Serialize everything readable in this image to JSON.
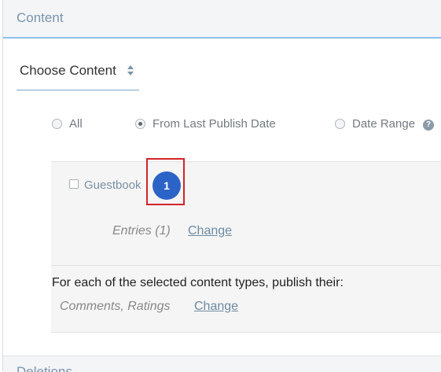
{
  "section": {
    "title": "Content"
  },
  "chooser": {
    "label": "Choose Content"
  },
  "radios": [
    {
      "label": "All",
      "checked": false
    },
    {
      "label": "From Last Publish Date",
      "checked": true
    },
    {
      "label": "Date Range",
      "checked": false
    }
  ],
  "help": {
    "glyph": "?"
  },
  "content_types": [
    {
      "label": "Guestbook",
      "checked": false,
      "badge": "1"
    }
  ],
  "entries": {
    "text": "Entries (1)",
    "change_label": "Change"
  },
  "publish": {
    "prompt": "For each of the selected content types, publish their:",
    "items_text": "Comments, Ratings",
    "change_label": "Change"
  },
  "next_section": {
    "title": "Deletions"
  },
  "colors": {
    "accent": "#8cc1ea",
    "badge": "#2b64c6",
    "highlight": "#d3232a",
    "link": "#6d8aa2"
  }
}
